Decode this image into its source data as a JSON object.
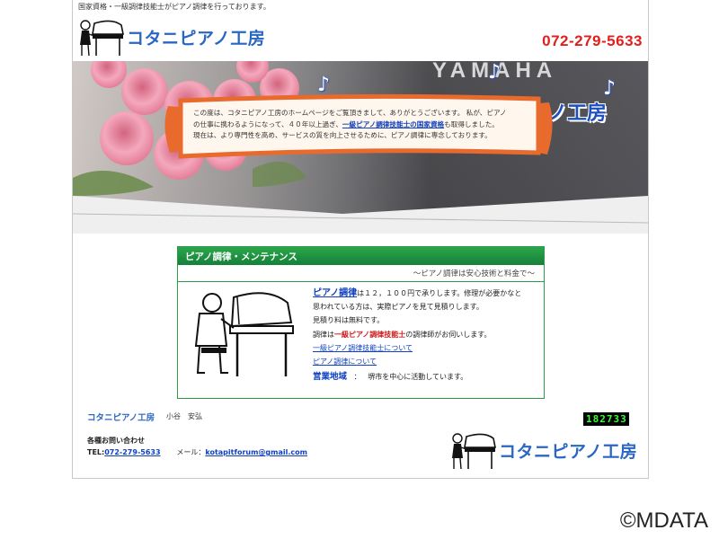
{
  "header": {
    "tagline": "国家資格・一級調律技能士がピアノ調律を行っております。",
    "brand": "コタニピアノ工房",
    "phone": "072-279-5633",
    "logo_icon": "pianist-icon"
  },
  "hero": {
    "title": "ピアノ調律のコタニピアノ工房",
    "brand_partial": "YAMAHA",
    "intro_1": "この度は、コタニピアノ工房のホームページをご覧頂きまして、ありがとうございます。 私が、ピアノ",
    "intro_2a": "の仕事に携わるようになって、４０年以上過ぎ、",
    "intro_2b": "一級ピアノ調律技能士の国家資格",
    "intro_2c": "も取得しました。",
    "intro_3": "現在は、より専門性を高め、サービスの質を向上させるために、ピアノ調律に専念しております。"
  },
  "maintenance": {
    "heading": "ピアノ調律・メンテナンス",
    "subheading": "～ピアノ調律は安心技術と料金で～",
    "price_link": "ピアノ調律",
    "price_text": "は１２，１００円で承りします。修理が必要かなと",
    "line2": "思われている方は、実際ピアノを見て見積りします。",
    "line3": "見積り料は無料です。",
    "line4a": "調律は",
    "line4b": "一級ピアノ調律技能士",
    "line4c": "の調律師がお伺いします。",
    "link1": "一級ピアノ調律技能士について",
    "link2": "ピアノ調律について",
    "area_label": "営業地域",
    "area_sep": "：",
    "area_text": "堺市を中心に活動しています。"
  },
  "footer": {
    "brand": "コタニピアノ工房",
    "person": "小谷　安弘",
    "counter": [
      "1",
      "8",
      "2",
      "7",
      "3",
      "3"
    ],
    "contact_title": "各種お問い合わせ",
    "tel_label": "TEL:",
    "tel": "072-279-5633",
    "mail_label": "メール：",
    "mail": "kotapitforum@gmail.com",
    "logo_text": "コタニピアノ工房"
  },
  "copyright": "©MDATA",
  "colors": {
    "brand_blue": "#2a66c4",
    "phone_red": "#e0201e",
    "green": "#1e8e3e"
  }
}
